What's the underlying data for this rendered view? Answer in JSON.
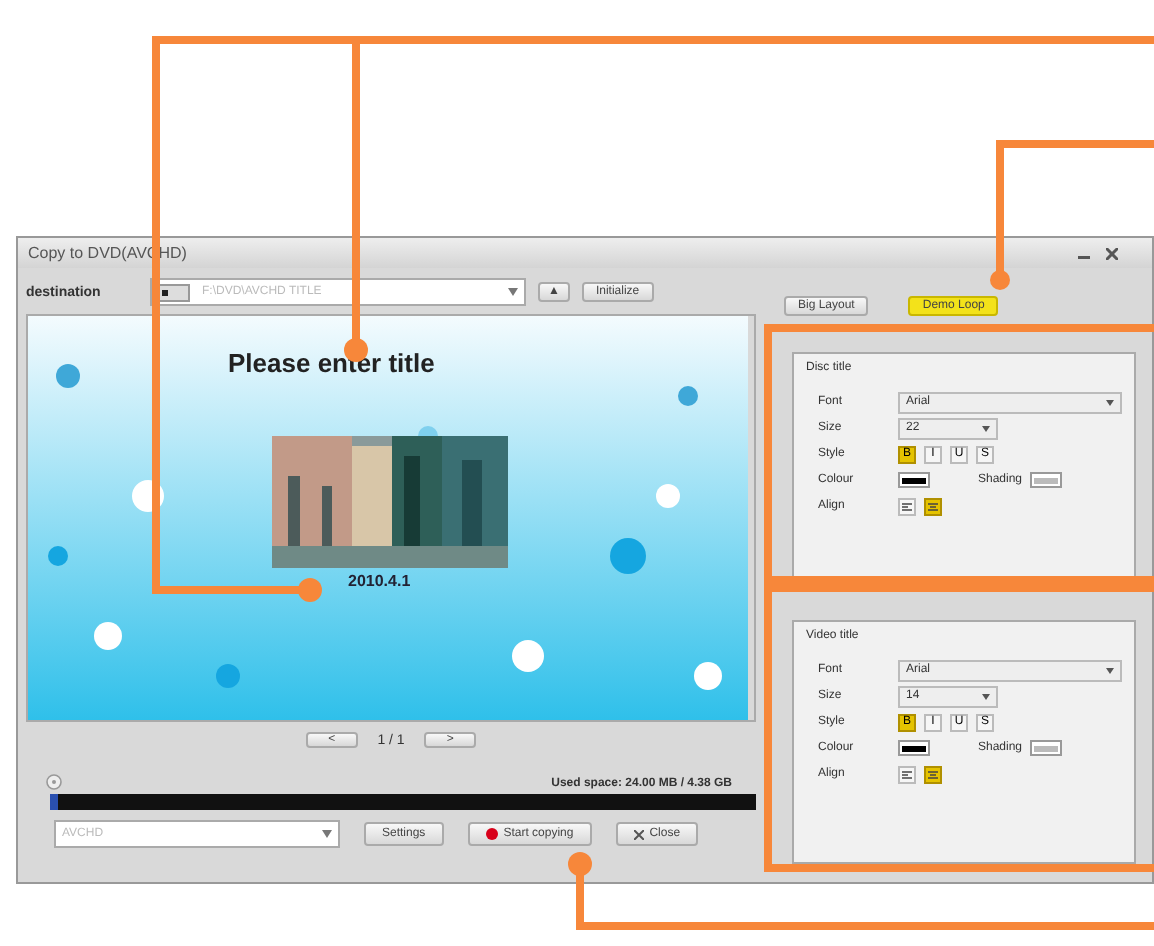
{
  "window": {
    "title": "Copy to DVD(AVCHD)"
  },
  "toolbar": {
    "label": "destination",
    "path": "F:\\DVD\\AVCHD TITLE",
    "buttons": [
      {
        "label": "▲",
        "kind": "icon"
      },
      {
        "label": "Initialize",
        "kind": "text"
      }
    ]
  },
  "layout_buttons": [
    {
      "label": "Big Layout",
      "highlighted": false
    },
    {
      "label": "Demo Loop",
      "highlighted": true
    }
  ],
  "preview": {
    "title": "Please enter title",
    "date": "2010.4.1"
  },
  "pager": {
    "previous": "<",
    "page": "1 / 1",
    "next": ">"
  },
  "used_space": "Used space: 24.00 MB / 4.38 GB",
  "progress": {
    "level": 0.01
  },
  "format": {
    "value": "AVCHD"
  },
  "actions": [
    {
      "label": "Settings",
      "kind": "plain"
    },
    {
      "label": "Start copying",
      "kind": "record"
    },
    {
      "label": "Close",
      "kind": "close"
    }
  ],
  "panels": [
    {
      "title": "Disc title",
      "font_label": "Font",
      "font": "Arial",
      "size_label": "Size",
      "size": "22",
      "style_label": "Style",
      "styles": [
        {
          "label": "B",
          "on": true
        },
        {
          "label": "I",
          "on": false
        },
        {
          "label": "U",
          "on": false
        },
        {
          "label": "S",
          "on": false
        }
      ],
      "colour_label": "Colour",
      "shading_label": "Shading",
      "align_label": "Align",
      "align": [
        {
          "selected": false
        },
        {
          "selected": true
        }
      ]
    },
    {
      "title": "Video title",
      "font_label": "Font",
      "font": "Arial",
      "size_label": "Size",
      "size": "14",
      "style_label": "Style",
      "styles": [
        {
          "label": "B",
          "on": true
        },
        {
          "label": "I",
          "on": false
        },
        {
          "label": "U",
          "on": false
        },
        {
          "label": "S",
          "on": false
        }
      ],
      "colour_label": "Colour",
      "shading_label": "Shading",
      "align_label": "Align",
      "align": [
        {
          "selected": false
        },
        {
          "selected": true
        }
      ]
    }
  ]
}
